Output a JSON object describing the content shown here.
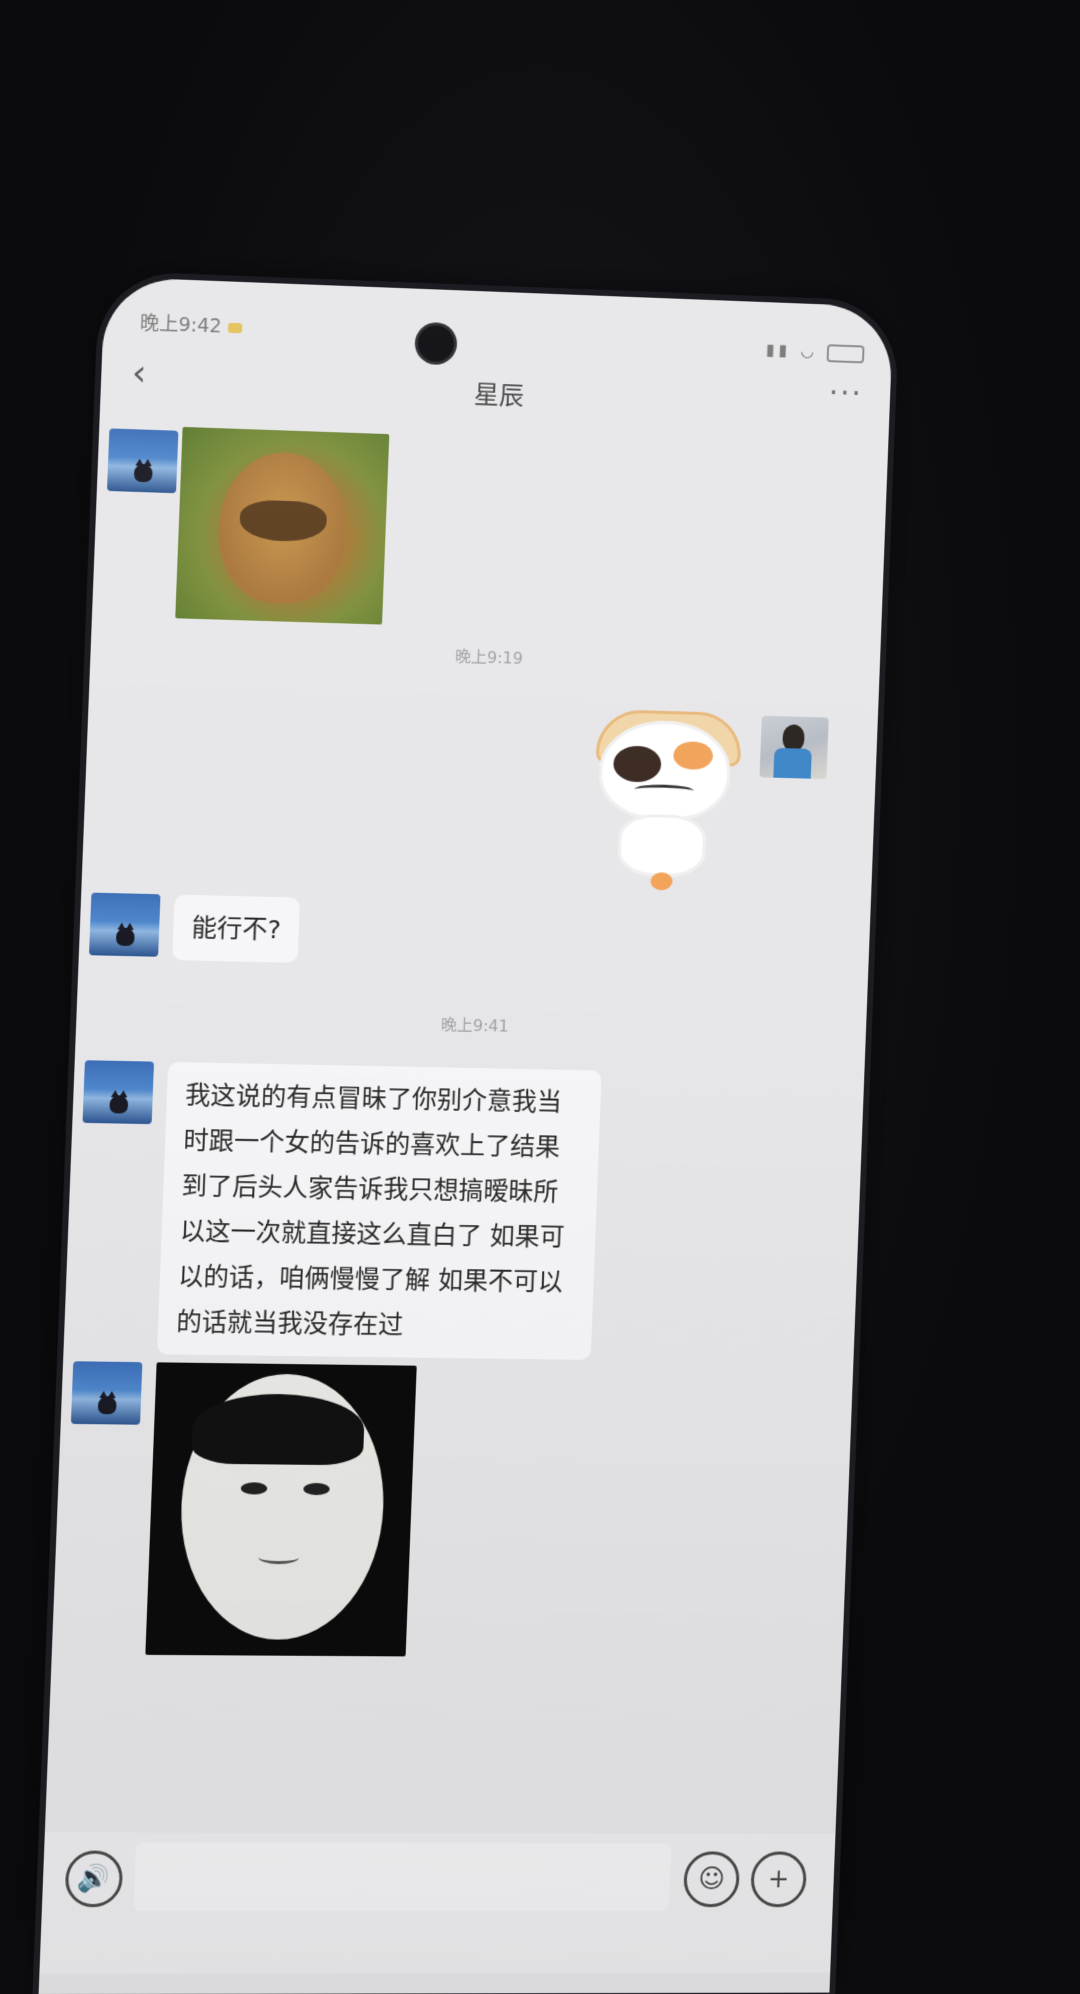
{
  "status_bar": {
    "time": "晚上9:42"
  },
  "header": {
    "back_icon": "‹",
    "title": "星辰",
    "more_icon": "···"
  },
  "messages": {
    "timestamp_1": "晚上9:19",
    "text_1": "能行不?",
    "timestamp_2": "晚上9:41",
    "text_2": "我这说的有点冒昧了你别介意我当时跟一个女的告诉的喜欢上了结果到了后头人家告诉我只想搞暧昧所以这一次就直接这么直白了 如果可以的话，咱俩慢慢了解 如果不可以的话就当我没存在过"
  },
  "input_bar": {
    "voice_icon": "🔊",
    "emoji_icon": "☺",
    "plus_icon": "+"
  }
}
